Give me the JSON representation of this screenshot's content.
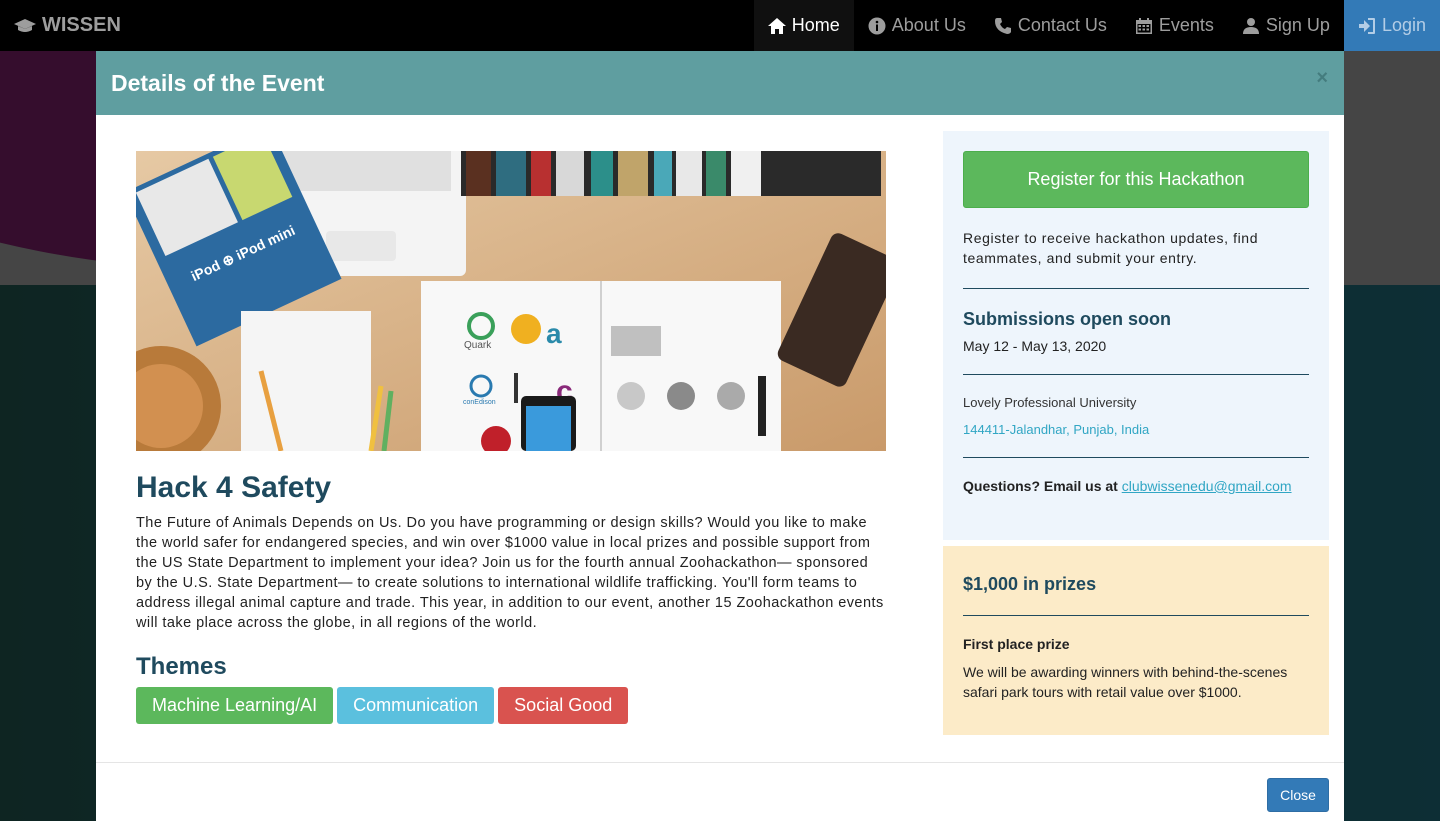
{
  "navbar": {
    "brand": "WISSEN",
    "items": [
      {
        "label": "Home",
        "icon": "home-icon",
        "active": true
      },
      {
        "label": "About Us",
        "icon": "info-icon"
      },
      {
        "label": "Contact Us",
        "icon": "phone-icon"
      },
      {
        "label": "Events",
        "icon": "calendar-icon"
      },
      {
        "label": "Sign Up",
        "icon": "user-icon"
      },
      {
        "label": "Login",
        "icon": "login-icon"
      }
    ]
  },
  "modal": {
    "title": "Details of the Event",
    "close_x": "×",
    "event": {
      "title": "Hack 4 Safety",
      "description": "The Future of Animals Depends on Us. Do you have programming or design skills? Would you like to make the world safer for endangered species, and win over $1000 value in local prizes and possible support from the US State Department to implement your idea? Join us for the fourth annual Zoohackathon— sponsored by the U.S. State Department— to create solutions to international wildlife trafficking. You'll form teams to address illegal animal capture and trade. This year, in addition to our event, another 15 Zoohackathon events will take place across the globe, in all regions of the world.",
      "themes_title": "Themes",
      "themes": [
        {
          "label": "Machine Learning/AI",
          "color": "#5cb85c"
        },
        {
          "label": "Communication",
          "color": "#5bc0de"
        },
        {
          "label": "Social Good",
          "color": "#d9534f"
        }
      ]
    },
    "registration": {
      "button": "Register for this Hackathon",
      "text": "Register to receive hackathon updates, find teammates, and submit your entry.",
      "submissions_title": "Submissions open soon",
      "dates": "May 12 - May 13, 2020",
      "location_name": "Lovely Professional University",
      "location_address": "144411-Jalandhar, Punjab, India",
      "questions_label": "Questions? Email us at ",
      "email": "clubwissenedu@gmail.com"
    },
    "prizes": {
      "title": "$1,000 in prizes",
      "first_label": "First place prize",
      "first_text": "We will be awarding winners with behind-the-scenes safari park tours with retail value over $1000."
    },
    "close_button": "Close"
  },
  "image_text": {
    "ipod": "iPod ⊕ iPod mini",
    "quark": "Quark",
    "conedison": "conEdison"
  }
}
